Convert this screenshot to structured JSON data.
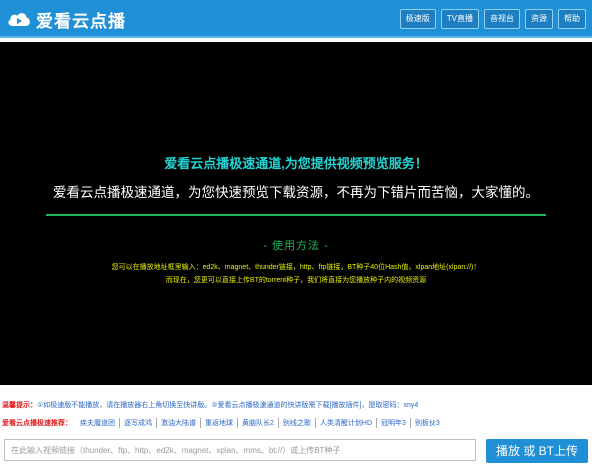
{
  "header": {
    "title": "爱看云点播",
    "logo_icon": "cloud-play-icon",
    "nav": [
      "极速版",
      "TV直播",
      "音视台",
      "资源",
      "帮助"
    ]
  },
  "player": {
    "title1": "爱看云点播极速通道,为您提供视频预览服务！",
    "title2": "爱看云点播极速通道，为您快速预览下载资源，不再为下错片而苦恼，大家懂的。",
    "howto": "- 使用方法 -",
    "desc1": "您可以在播放地址框里输入：ed2k、magnet、thunder链接，http、ftp链接，BT种子40位Hash值，xlpan地址(xlpan://)！",
    "desc2": "而现在，您更可以直接上传BT的torrent种子，我们将直接为您播放种子内的视频资源"
  },
  "tip": {
    "label": "温馨提示：",
    "text": "①如极速版不能播放，请在播放器右上角切换至快讲版。②爱看云点播极速通道的快讲版需下载[播放插件]，提取密码：xny4"
  },
  "recommend": {
    "label": "爱看云点播极速推荐：",
    "items": [
      "疾夫魔道团",
      "逐写成鸿",
      "激油大陆谱",
      "重返地球",
      "黄脑队长2",
      "别线之歌",
      "人类清醒计划HD",
      "冠明年3",
      "别板伙3"
    ]
  },
  "input": {
    "placeholder": "在此输入视频链接（thunder、ftp、http、ed2k、magnet、xplan、mms、bt://）或上传BT种子"
  },
  "play_button": "播放 或 BT上传",
  "colors": {
    "header_bg": "#1f8fd6",
    "title_cyan": "#22d3d3",
    "accent_green": "#1fb35a",
    "desc_yellow": "#e8f000",
    "tip_red": "#e02020",
    "link_blue": "#2a66c4"
  }
}
